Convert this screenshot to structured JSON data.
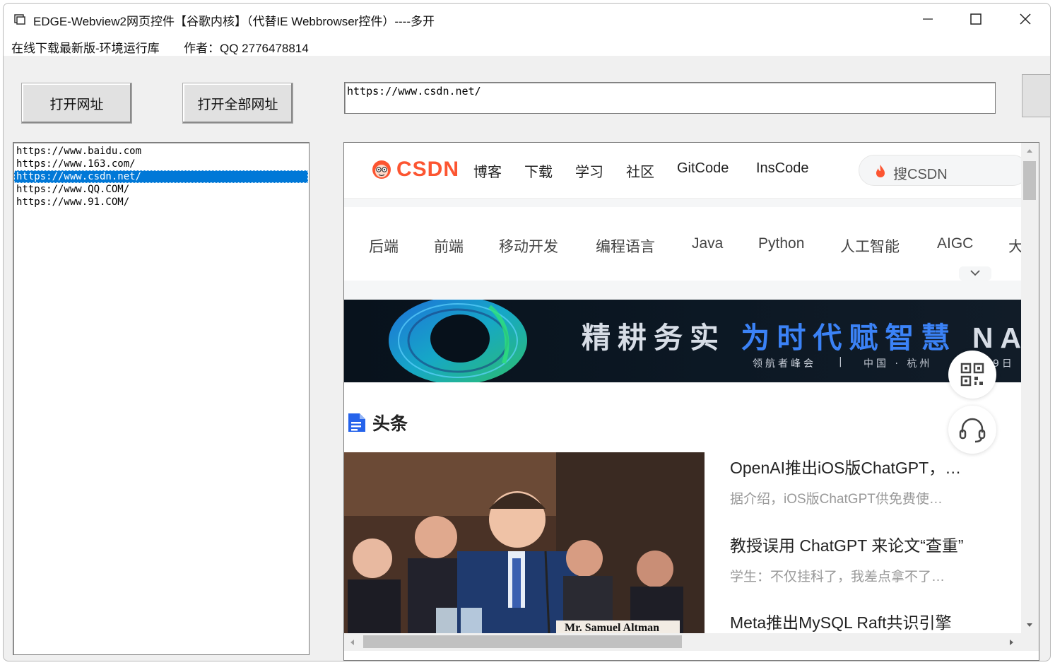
{
  "window": {
    "title": "EDGE-Webview2网页控件【谷歌内核】（代替IE Webbrowser控件）----多开",
    "minimize_label": "minimize",
    "maximize_label": "maximize",
    "close_label": "close"
  },
  "menubar": {
    "item1": "在线下载最新版-环境运行库",
    "item2": "作者：QQ 2776478814"
  },
  "toolbar": {
    "open_url_label": "打开网址",
    "open_all_label": "打开全部网址",
    "url_value": "https://www.csdn.net/"
  },
  "url_list": [
    {
      "text": "https://www.baidu.com",
      "selected": false
    },
    {
      "text": "https://www.163.com/",
      "selected": false
    },
    {
      "text": "https://www.csdn.net/",
      "selected": true
    },
    {
      "text": "https://www.QQ.COM/",
      "selected": false
    },
    {
      "text": "https://www.91.COM/",
      "selected": false
    }
  ],
  "csdn": {
    "logo_text": "CSDN",
    "nav": [
      "博客",
      "下载",
      "学习",
      "社区",
      "GitCode",
      "InsCode"
    ],
    "search_placeholder": "搜CSDN",
    "categories": [
      "后端",
      "前端",
      "移动开发",
      "编程语言",
      "Java",
      "Python",
      "人工智能",
      "AIGC",
      "大"
    ],
    "banner": {
      "title_part1": "精耕务实",
      "title_part2": "为时代赋智慧",
      "title_part3": "NAV",
      "sub_left": "领航者峰会",
      "sub_sep": "|",
      "sub_mid": "中国 · 杭州",
      "sub_right": "9日"
    },
    "headline_label": "头条",
    "photo_caption": "Mr. Samuel Altman",
    "articles": [
      {
        "title": "OpenAI推出iOS版ChatGPT，…",
        "desc": "据介绍，iOS版ChatGPT供免费使…"
      },
      {
        "title": "教授误用 ChatGPT 来论文“查重”",
        "desc": "学生：不仅挂科了，我差点拿不了…"
      },
      {
        "title": "Meta推出MySQL Raft共识引擎",
        "desc": ""
      }
    ]
  },
  "colors": {
    "accent": "#fc5531",
    "selection": "#0078d7",
    "banner_highlight": "#3b82f6"
  }
}
